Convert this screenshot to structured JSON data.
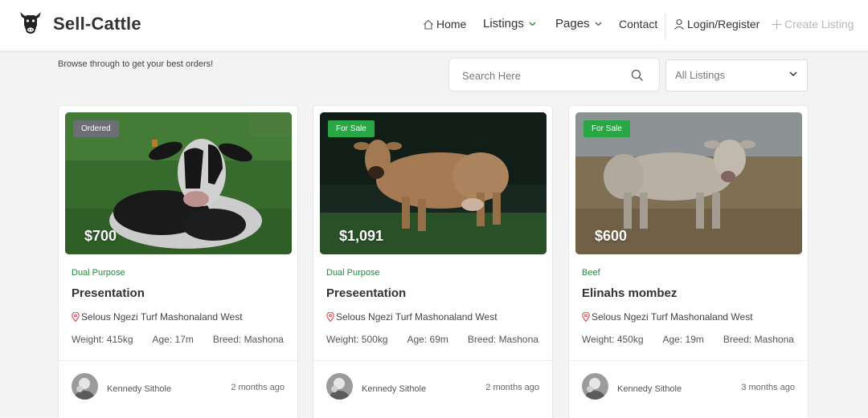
{
  "header": {
    "brand": "Sell-Cattle",
    "nav": {
      "home": "Home",
      "listings": "Listings",
      "pages": "Pages",
      "contact": "Contact",
      "login": "Login/Register",
      "create": "Create Listing"
    }
  },
  "subheader": {
    "subtitle": "Browse through to get your best orders!",
    "search_placeholder": "Search Here",
    "filter_selected": "All Listings"
  },
  "colors": {
    "accent_green": "#28a745",
    "category_green": "#1e8a3a",
    "badge_gray": "#6c6e73",
    "location_pin": "#e0434f"
  },
  "cards": [
    {
      "badge": "Ordered",
      "price": "$700",
      "category": "Dual Purpose",
      "title": "Presentation",
      "location": "Selous Ngezi Turf Mashonaland West",
      "weight": "Weight: 415kg",
      "age": "Age: 17m",
      "breed": "Breed: Mashona",
      "author": "Kennedy Sithole",
      "time": "2 months ago"
    },
    {
      "badge": "For Sale",
      "price": "$1,091",
      "category": "Dual Purpose",
      "title": "Preseentation",
      "location": "Selous Ngezi Turf Mashonaland West",
      "weight": "Weight: 500kg",
      "age": "Age: 69m",
      "breed": "Breed: Mashona",
      "author": "Kennedy Sithole",
      "time": "2 months ago"
    },
    {
      "badge": "For Sale",
      "price": "$600",
      "category": "Beef",
      "title": "Elinahs mombez",
      "location": "Selous Ngezi Turf Mashonaland West",
      "weight": "Weight: 450kg",
      "age": "Age: 19m",
      "breed": "Breed: Mashona",
      "author": "Kennedy Sithole",
      "time": "3 months ago"
    }
  ]
}
